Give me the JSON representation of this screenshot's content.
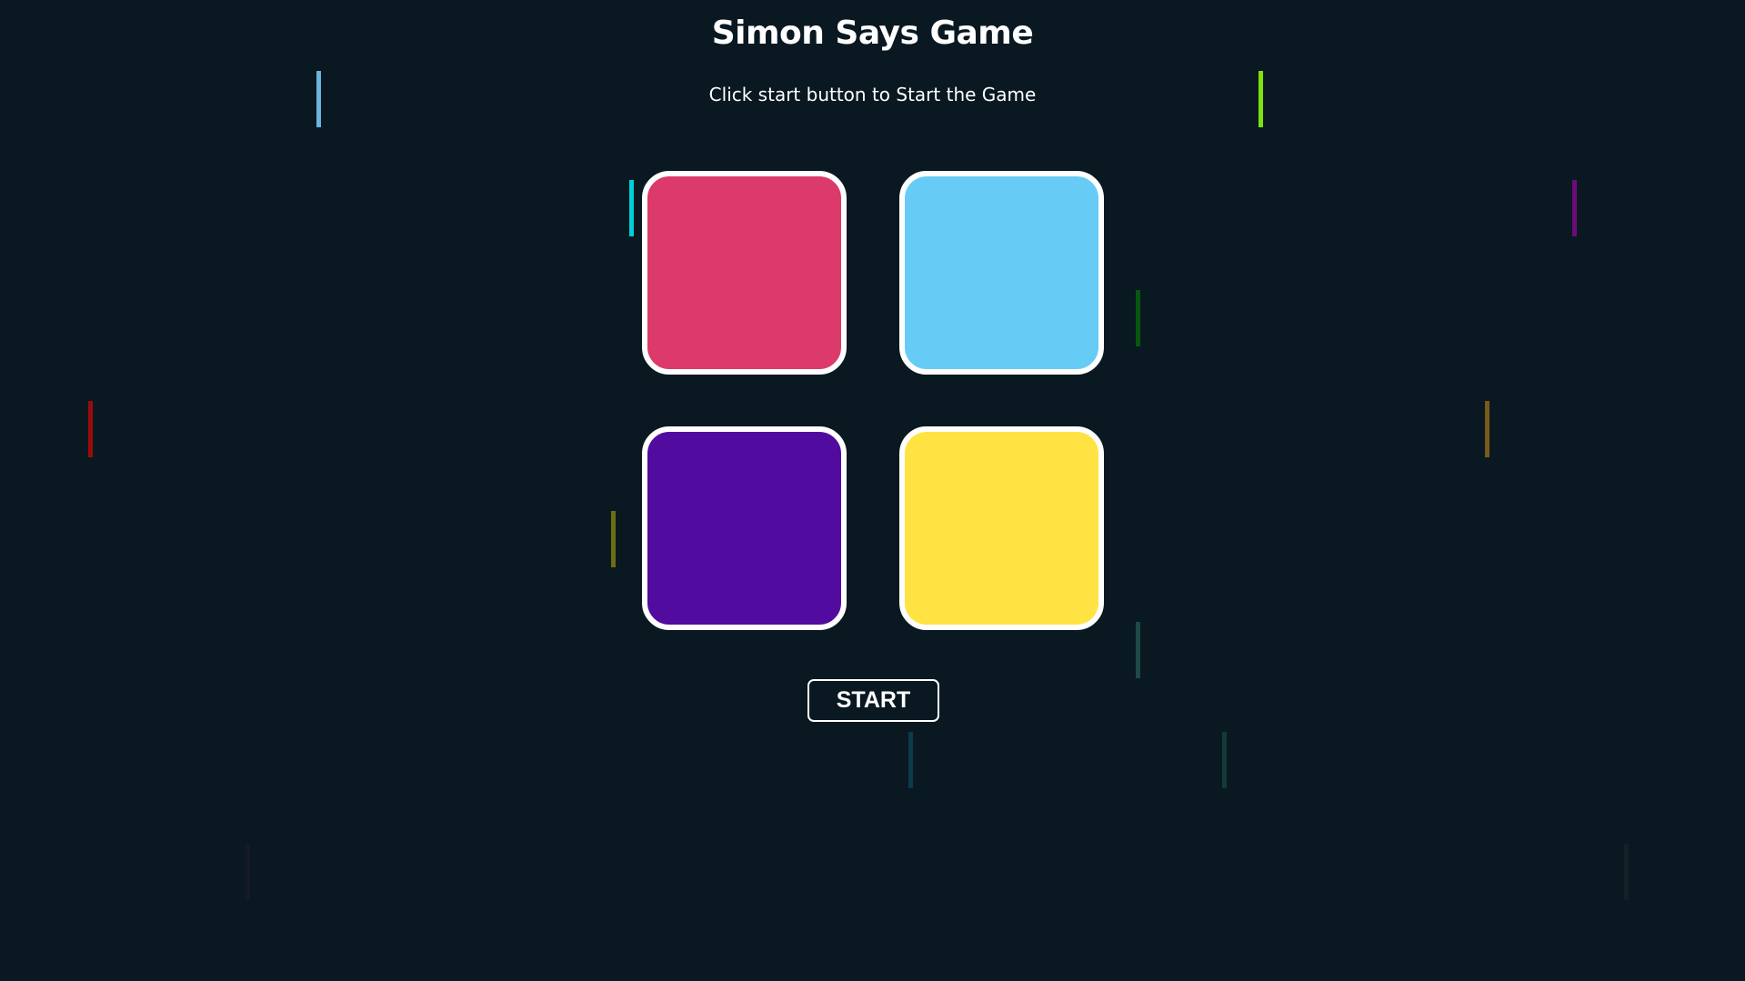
{
  "header": {
    "title": "Simon Says Game",
    "status": "Click start button to Start the Game"
  },
  "pads": [
    {
      "id": "red",
      "color": "#db3a6a"
    },
    {
      "id": "blue",
      "color": "#66ccf5"
    },
    {
      "id": "purple",
      "color": "#520b9f"
    },
    {
      "id": "yellow",
      "color": "#ffe342"
    }
  ],
  "controls": {
    "start_label": "START"
  },
  "background": {
    "color": "#0a1821",
    "streak_colors": [
      "#6ab4de",
      "#7fe10c",
      "#00cfd6",
      "#6f0a7a",
      "#07580f",
      "#9b0a0a",
      "#7a5a18",
      "#6d6d10",
      "#1e4a47",
      "#0b3a4a",
      "#123a36",
      "#141a26",
      "#141f28"
    ]
  }
}
